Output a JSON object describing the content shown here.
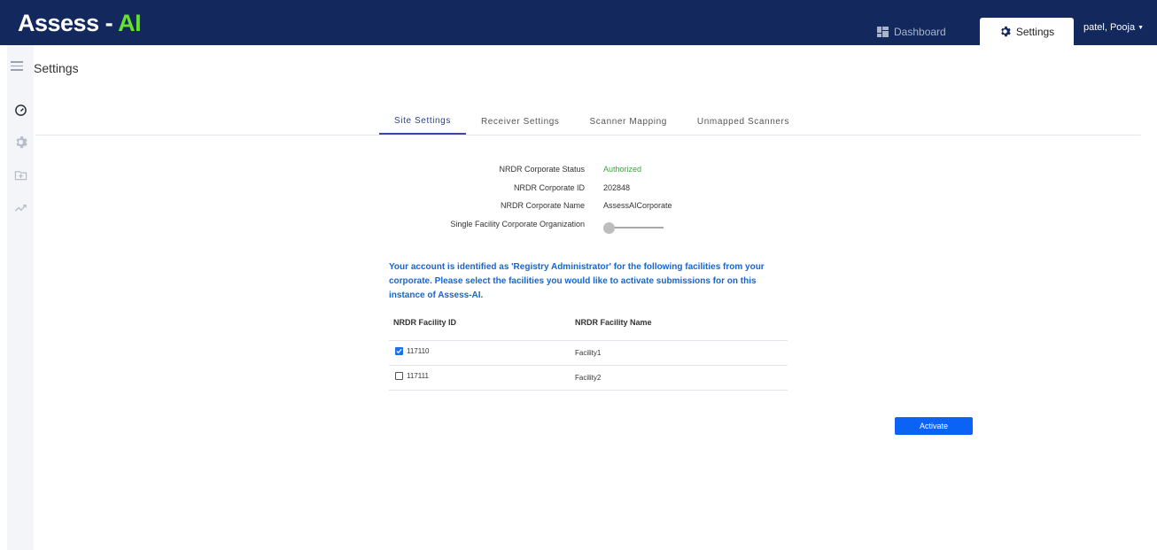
{
  "app": {
    "logo_main": "Assess - ",
    "logo_accent": "AI"
  },
  "topnav": {
    "dashboard": "Dashboard",
    "settings": "Settings",
    "user": "patel, Pooja"
  },
  "page": {
    "title": "Settings"
  },
  "tabs": [
    {
      "label": "Site Settings",
      "active": true
    },
    {
      "label": "Receiver Settings",
      "active": false
    },
    {
      "label": "Scanner Mapping",
      "active": false
    },
    {
      "label": "Unmapped Scanners",
      "active": false
    }
  ],
  "info": {
    "status_label": "NRDR Corporate Status",
    "status_value": "Authorized",
    "id_label": "NRDR Corporate ID",
    "id_value": "202848",
    "name_label": "NRDR Corporate Name",
    "name_value": "AssessAICorporate",
    "single_facility_label": "Single Facility Corporate Organization",
    "single_facility_on": false
  },
  "notice": "Your account is identified as 'Registry Administrator' for the following facilities from your corporate. Please select the facilities you would like to activate submissions for on this instance of Assess-AI.",
  "table": {
    "headers": [
      "NRDR Facility ID",
      "NRDR Facility Name"
    ],
    "rows": [
      {
        "id": "117110",
        "name": "Facility1",
        "checked": true
      },
      {
        "id": "117111",
        "name": "Facility2",
        "checked": false
      }
    ]
  },
  "actions": {
    "activate": "Activate"
  },
  "colors": {
    "topbar": "#13285c",
    "logo_accent": "#66e12e",
    "status_ok": "#3aa63a",
    "notice": "#1565d8",
    "primary_button": "#0b63f6"
  },
  "icons": {
    "dashboard": "dashboard-grid-icon",
    "settings": "gear-icon",
    "menu": "hamburger-icon",
    "sidebar": [
      "speedometer-icon",
      "gear-icon",
      "folder-upload-icon",
      "trend-chart-icon"
    ]
  }
}
